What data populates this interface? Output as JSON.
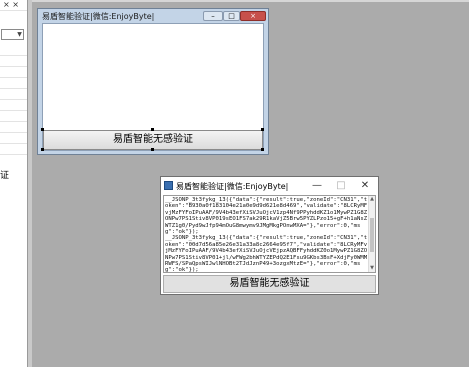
{
  "ide": {
    "pin_glyph": "× ×",
    "side_text": "证"
  },
  "designer_form": {
    "title": "易盾智能验证|微信:EnjoyByte|",
    "min_label": "–",
    "max_label": "□",
    "close_label": "×",
    "button_label": "易盾智能无感验证"
  },
  "running_window": {
    "title": "易盾智能验证|微信:EnjoyByte|",
    "min_label": "—",
    "max_label": "□",
    "close_label": "✕",
    "log_text": "__JSONP_3t3fykg_13({\"data\":{\"result\":true,\"zoneId\":\"CN31\",\"token\":\"B930a0f183104e21a0e9d9d621e8d469\",\"validate\":\"8LCRyMFvjMzFYFoIPuAAF/9V4b43efXiSVJuOjcV1zp4Nf9PPyhddKZ1o1MywPZ1G8ZONPw7PS1Stiv8VP019sEO1FS7ak29R1kaVjZ5Brw5PYZLPzo15+gF+h1aNsZWTZ1g0/Pyd9wJfp94mOuG8mwymv9JMgMkgPOnwMXA=\"},\"error\":0,\"msg\":\"ok\"});\n__JSONP_3t3fykg_13({\"data\":{\"result\":true,\"zoneId\":\"CN31\",\"token\":\"00d7d56a85e26e31a33a8c2664e95f7\",\"validate\":\"8LCRyMFvjMzFYFoIPuAAF/9V4b43efXiSVJuOjcVEjpzAQBFFyhddKZ0o1MywPZ1G8ZONPw7PS1Stiv8VP01+jl/wFWg2bhWTYZEPdQ2E1Fsu9GKbs3BsF+XdjFy0WMMRWFS/SPaQpsWIJwlNHOBt2TJdJznP49+3ozgxMtzE=\"},\"error\":0,\"msg\":\"ok\"});",
    "button_label": "易盾智能无感验证"
  }
}
